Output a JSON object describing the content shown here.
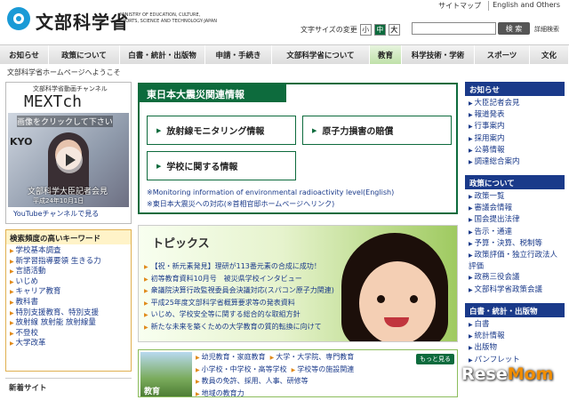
{
  "header": {
    "logo_ja": "文部科学省",
    "logo_en": "MINISTRY OF EDUCATION, CULTURE, SPORTS, SCIENCE AND TECHNOLOGY-JAPAN",
    "sitemap": "サイトマップ",
    "english": "English and Others",
    "font_size_label": "文字サイズの変更",
    "fs_small": "小",
    "fs_medium": "中",
    "fs_large": "大",
    "search_button": "検 索",
    "advanced_search": "詳細検索"
  },
  "nav": [
    "お知らせ",
    "政策について",
    "白書・統計・出版物",
    "申請・手続き",
    "文部科学省について",
    "教育",
    "科学技術・学術",
    "スポーツ",
    "文化"
  ],
  "greeting": "文部科学省ホームページへようこそ",
  "mext": {
    "channel_label": "文部科学省動画チャンネル",
    "title": "MEXTch",
    "video_top": "画像をクリックして下さい",
    "video_kyo": "KYO",
    "video_caption": "文部科学大臣記者会見",
    "video_date": "平成24年10月1日",
    "youtube_link": "YouTubeチャンネルで見る"
  },
  "keywords": {
    "title": "検索頻度の高いキーワード",
    "items": [
      "学校基本調査",
      "新学習指導要領 生きる力",
      "言語活動",
      "いじめ",
      "キャリア教育",
      "教科書",
      "特別支援教育、特別支援",
      "放射線 放射能 放射線量",
      "不登校",
      "大学改革"
    ]
  },
  "new_site_title": "新着サイト",
  "quake": {
    "title": "東日本大震災関連情報",
    "btn_radiation": "放射線モニタリング情報",
    "btn_nuclear": "原子力損害の賠償",
    "btn_school": "学校に関する情報",
    "link1": "※Monitoring information of environmental radioactivity level(English)",
    "link2": "※東日本大震災への対応(※首相官邸ホームページへリンク)"
  },
  "topics": {
    "title": "トピックス",
    "items": [
      "【祝・新元素発見】理研が113番元素の合成に成功！",
      "初等教育資料10月号　被災県学校インタビュー",
      "衆議院決算行政監視委員会決議対応(スパコン原子力関連)",
      "平成25年度文部科学省概算要求等の発表資料",
      "いじめ、学校安全等に関する総合的な取組方針",
      "新たな未来を築くための大学教育の質的転換に向けて"
    ]
  },
  "edu": {
    "label": "教育",
    "more": "もっと見る",
    "rows": [
      [
        "幼児教育・家庭教育",
        "大学・大学院、専門教育"
      ],
      [
        "小学校・中学校・高等学校",
        "学校等の施設関連"
      ],
      [
        "教員の免許、採用、人事、研修等"
      ],
      [
        "地域の教育力"
      ]
    ]
  },
  "right": {
    "news": {
      "title": "お知らせ",
      "items": [
        "大臣記者会見",
        "報道発表",
        "行事案内",
        "採用案内",
        "公募情報",
        "調達総合案内"
      ]
    },
    "policy": {
      "title": "政策について",
      "items": [
        "政策一覧",
        "審議会情報",
        "国会提出法律",
        "告示・通達",
        "予算・決算、税制等",
        "政策評価・独立行政法人評価",
        "政務三役会議",
        "文部科学省政策会議"
      ]
    },
    "white": {
      "title": "白書・統計・出版物",
      "items": [
        "白書",
        "統計情報",
        "出版物",
        "パンフレット"
      ]
    }
  },
  "watermark_a": "Rese",
  "watermark_b": "Mom",
  "colors": {
    "brand_green": "#0d6b3d",
    "nav_blue": "#1a3a8a",
    "accent_orange": "#e08a1a"
  }
}
